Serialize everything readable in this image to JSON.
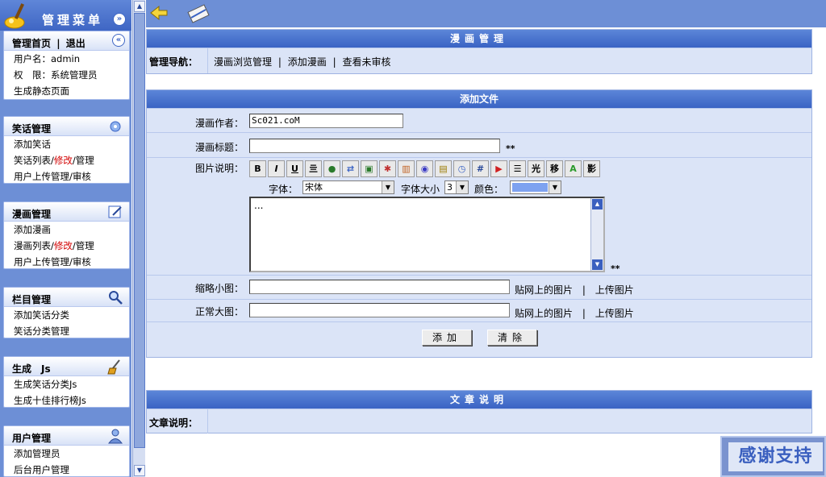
{
  "sidebar": {
    "title": "管理菜单",
    "top_box": {
      "home": "管理首页",
      "sep": "|",
      "logout": "退出",
      "username_line": "用户名：admin",
      "role_line": "权　限：系统管理员",
      "static_link": "生成静态页面"
    },
    "sections": [
      {
        "title": "笑话管理",
        "icon": "gear-icon",
        "items": [
          [
            "添加笑话"
          ],
          [
            "笑话列表/",
            "修改",
            "/管理"
          ],
          [
            "用户上传管理/审核"
          ]
        ]
      },
      {
        "title": "漫画管理",
        "icon": "edit-icon",
        "items": [
          [
            "添加漫画"
          ],
          [
            "漫画列表/",
            "修改",
            "/管理"
          ],
          [
            "用户上传管理/审核"
          ]
        ]
      },
      {
        "title": "栏目管理",
        "icon": "search-icon",
        "items": [
          [
            "添加笑话分类"
          ],
          [
            "笑话分类管理"
          ]
        ]
      },
      {
        "title": "生成　Js",
        "icon": "broom-icon",
        "items": [
          [
            "生成笑话分类Js"
          ],
          [
            "生成十佳排行榜Js"
          ]
        ]
      },
      {
        "title": "用户管理",
        "icon": "user-icon",
        "items": [
          [
            "添加管理员"
          ],
          [
            "后台用户管理"
          ]
        ]
      }
    ]
  },
  "nav_panel": {
    "title": "漫画管理",
    "label": "管理导航：",
    "links": [
      "漫画浏览管理",
      "添加漫画",
      "查看未审核"
    ],
    "sep": "|"
  },
  "form_panel": {
    "title": "添加文件",
    "author_label": "漫画作者：",
    "author_value": "Sc021.coM",
    "title_label": "漫画标题：",
    "title_value": "",
    "required_mark": "**",
    "desc_label": "图片说明：",
    "toolbar_glyphs": [
      "B",
      "I",
      "U",
      "亖",
      "●",
      "⇄",
      "▣",
      "✱",
      "▥",
      "◉",
      "▤",
      "◷",
      "#",
      "▶",
      "☰",
      "光",
      "移",
      "A",
      "影"
    ],
    "font_label": "字体：",
    "font_value": "宋体",
    "size_label": "字体大小",
    "size_value": "3",
    "color_label": "颜色：",
    "color_value": "#7ea2f0",
    "editor_text": "...",
    "thumb_label": "缩略小图：",
    "full_label": "正常大图：",
    "web_image_link": "贴网上的图片",
    "upload_link": "上传图片",
    "add_button": "添加",
    "clear_button": "清除"
  },
  "article_panel": {
    "title": "文章说明",
    "label": "文章说明："
  },
  "badge": {
    "text": "感谢支持"
  },
  "colors": {
    "header_blue": "#3a63c4",
    "panel_bg": "#dbe4f7",
    "side_bg": "#6d8fd6"
  }
}
